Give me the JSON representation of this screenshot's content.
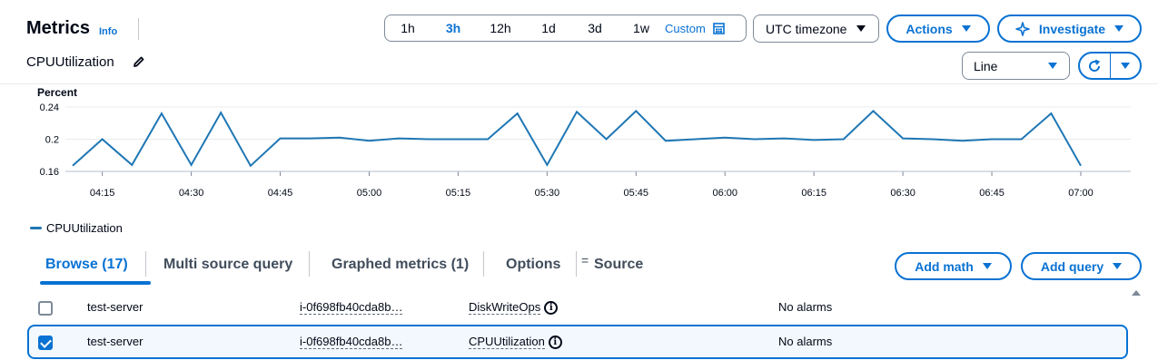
{
  "header": {
    "title": "Metrics",
    "info": "Info",
    "metric_name": "CPUUtilization"
  },
  "time_range": {
    "options": [
      "1h",
      "3h",
      "12h",
      "1d",
      "3d",
      "1w"
    ],
    "selected": "3h",
    "custom_label": "Custom"
  },
  "timezone": {
    "label": "UTC timezone"
  },
  "buttons": {
    "actions": "Actions",
    "investigate": "Investigate",
    "add_math": "Add math",
    "add_query": "Add query"
  },
  "graph_type": {
    "value": "Line"
  },
  "chart_data": {
    "type": "line",
    "ylabel": "Percent",
    "y_ticks": [
      "0.24",
      "0.2",
      "0.16"
    ],
    "ylim": [
      0.16,
      0.24
    ],
    "x_ticks": [
      "04:15",
      "04:30",
      "04:45",
      "05:00",
      "05:15",
      "05:30",
      "05:45",
      "06:00",
      "06:15",
      "06:30",
      "06:45",
      "07:00"
    ],
    "series": [
      {
        "name": "CPUUtilization",
        "color": "#1f77b4",
        "x": [
          "04:10",
          "04:15",
          "04:20",
          "04:25",
          "04:30",
          "04:35",
          "04:40",
          "04:45",
          "04:50",
          "04:55",
          "05:00",
          "05:05",
          "05:10",
          "05:15",
          "05:20",
          "05:25",
          "05:30",
          "05:35",
          "05:40",
          "05:45",
          "05:50",
          "05:55",
          "06:00",
          "06:05",
          "06:10",
          "06:15",
          "06:20",
          "06:25",
          "06:30",
          "06:35",
          "06:40",
          "06:45",
          "06:50",
          "06:55",
          "07:00"
        ],
        "y": [
          0.167,
          0.2,
          0.168,
          0.232,
          0.168,
          0.233,
          0.167,
          0.201,
          0.201,
          0.202,
          0.198,
          0.201,
          0.2,
          0.2,
          0.2,
          0.232,
          0.168,
          0.234,
          0.2,
          0.235,
          0.198,
          0.2,
          0.202,
          0.2,
          0.201,
          0.199,
          0.2,
          0.235,
          0.201,
          0.2,
          0.198,
          0.2,
          0.2,
          0.232,
          0.167
        ]
      }
    ],
    "grid": true,
    "legend": "bottom-left"
  },
  "tabs": [
    {
      "label": "Browse (17)",
      "active": true
    },
    {
      "label": "Multi source query",
      "active": false
    },
    {
      "label": "Graphed metrics (1)",
      "active": false
    },
    {
      "label": "Options",
      "active": false
    },
    {
      "label": "Source",
      "active": false
    }
  ],
  "source_glyph": "=",
  "rows": [
    {
      "checked": false,
      "name": "test-server",
      "instance": "i-0f698fb40cda8b…",
      "metric": "DiskWriteOps",
      "alarms": "No alarms"
    },
    {
      "checked": true,
      "name": "test-server",
      "instance": "i-0f698fb40cda8b…",
      "metric": "CPUUtilization",
      "alarms": "No alarms"
    }
  ]
}
